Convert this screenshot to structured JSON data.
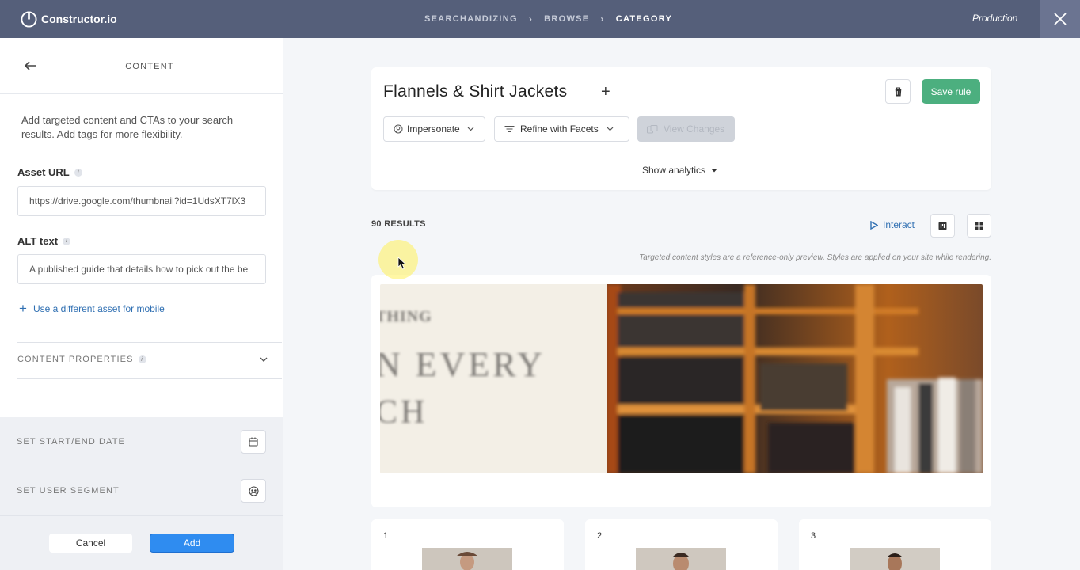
{
  "header": {
    "logo": "Constructor.io",
    "breadcrumbs": [
      "SEARCHANDIZING",
      "BROWSE",
      "CATEGORY"
    ],
    "environment": "Production"
  },
  "panel": {
    "title": "CONTENT",
    "description": "Add targeted content and CTAs to your search results. Add tags for more flexibility.",
    "asset_url_label": "Asset URL",
    "asset_url_value": "https://drive.google.com/thumbnail?id=1UdsXT7lX3",
    "alt_label": "ALT text",
    "alt_value": "A published guide that details how to pick out the be",
    "mobile_link": "Use a different asset for mobile",
    "content_properties": "CONTENT PROPERTIES",
    "start_end": "SET START/END DATE",
    "user_segment": "SET USER SEGMENT",
    "cancel": "Cancel",
    "add": "Add"
  },
  "rule": {
    "title": "Flannels & Shirt Jackets",
    "plus": "+",
    "save": "Save rule",
    "impersonate": "Impersonate",
    "refine": "Refine with Facets",
    "view_changes": "View Changes",
    "show_analytics": "Show analytics"
  },
  "results": {
    "count": "90 RESULTS",
    "interact": "Interact",
    "note": "Targeted content styles are a reference-only preview. Styles are applied on your site while rendering."
  },
  "products": [
    {
      "rank": "1"
    },
    {
      "rank": "2"
    },
    {
      "rank": "3"
    }
  ],
  "colors": {
    "topbar": "#555f7a",
    "accent": "#2f8cf0",
    "save": "#4caf7f",
    "link": "#2f6fb2"
  }
}
